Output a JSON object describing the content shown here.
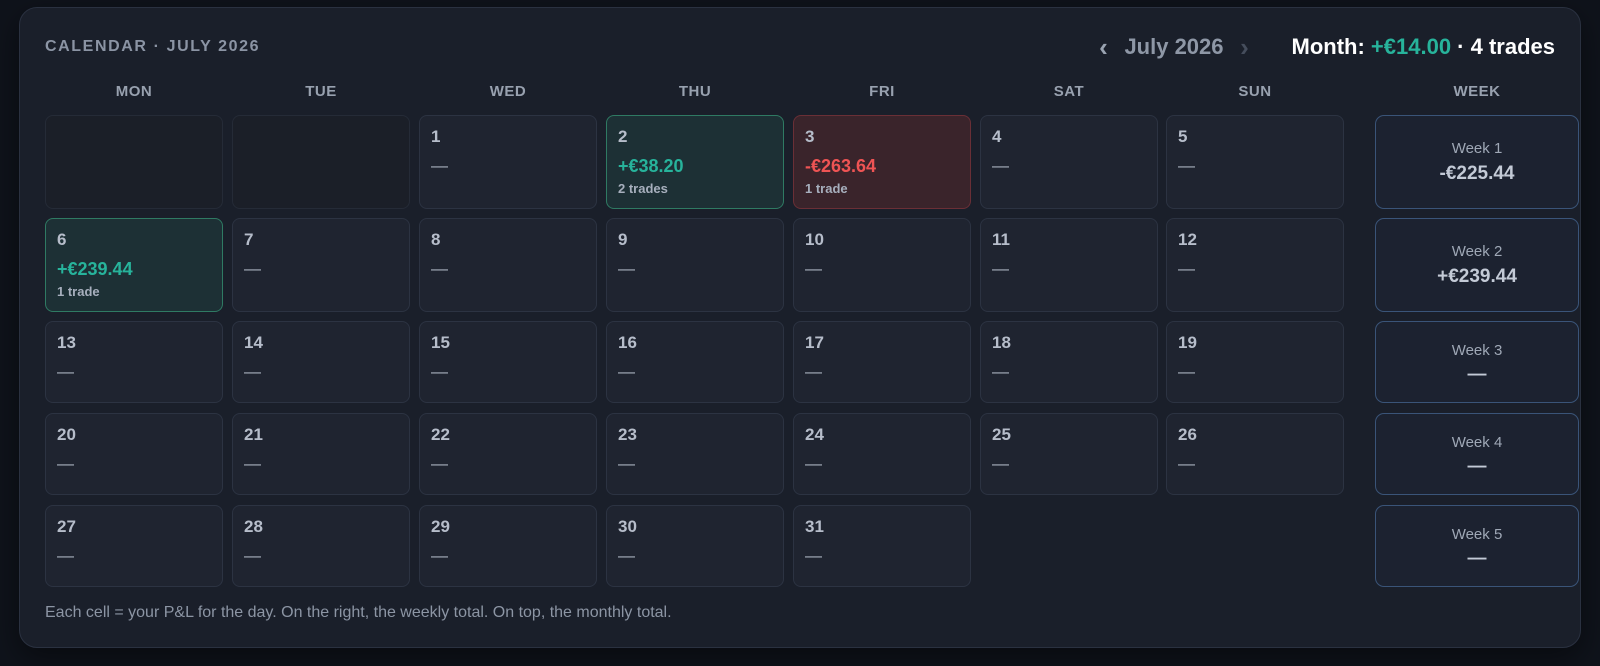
{
  "header": {
    "title": "CALENDAR · JULY 2026",
    "prev_icon": "chevron-left-icon",
    "next_icon": "chevron-right-icon",
    "prev_glyph": "‹",
    "next_glyph": "›",
    "month_label": "July 2026",
    "summary_prefix": "Month: ",
    "summary_value": "+€14.00",
    "summary_suffix": " · 4 trades"
  },
  "colors": {
    "positive": "#27b39b",
    "negative": "#ef5454",
    "background": "#0f131b",
    "panel": "#1a1f2a"
  },
  "weekdays": [
    "MON",
    "TUE",
    "WED",
    "THU",
    "FRI",
    "SAT",
    "SUN"
  ],
  "week_header": "WEEK",
  "weeks": [
    {
      "label": "Week 1",
      "total": "-€225.44",
      "status": "loss",
      "days": [
        {
          "day": "",
          "status": "empty"
        },
        {
          "day": "",
          "status": "empty"
        },
        {
          "day": "1",
          "pnl": "—",
          "status": "none"
        },
        {
          "day": "2",
          "pnl": "+€38.20",
          "trades": "2 trades",
          "status": "win"
        },
        {
          "day": "3",
          "pnl": "-€263.64",
          "trades": "1 trade",
          "status": "loss"
        },
        {
          "day": "4",
          "pnl": "—",
          "status": "none"
        },
        {
          "day": "5",
          "pnl": "—",
          "status": "none"
        }
      ]
    },
    {
      "label": "Week 2",
      "total": "+€239.44",
      "status": "win",
      "days": [
        {
          "day": "6",
          "pnl": "+€239.44",
          "trades": "1 trade",
          "status": "win"
        },
        {
          "day": "7",
          "pnl": "—",
          "status": "none"
        },
        {
          "day": "8",
          "pnl": "—",
          "status": "none"
        },
        {
          "day": "9",
          "pnl": "—",
          "status": "none"
        },
        {
          "day": "10",
          "pnl": "—",
          "status": "none"
        },
        {
          "day": "11",
          "pnl": "—",
          "status": "none"
        },
        {
          "day": "12",
          "pnl": "—",
          "status": "none"
        }
      ]
    },
    {
      "label": "Week 3",
      "total": "—",
      "status": "none",
      "days": [
        {
          "day": "13",
          "pnl": "—",
          "status": "none"
        },
        {
          "day": "14",
          "pnl": "—",
          "status": "none"
        },
        {
          "day": "15",
          "pnl": "—",
          "status": "none"
        },
        {
          "day": "16",
          "pnl": "—",
          "status": "none"
        },
        {
          "day": "17",
          "pnl": "—",
          "status": "none"
        },
        {
          "day": "18",
          "pnl": "—",
          "status": "none"
        },
        {
          "day": "19",
          "pnl": "—",
          "status": "none"
        }
      ]
    },
    {
      "label": "Week 4",
      "total": "—",
      "status": "none",
      "days": [
        {
          "day": "20",
          "pnl": "—",
          "status": "none"
        },
        {
          "day": "21",
          "pnl": "—",
          "status": "none"
        },
        {
          "day": "22",
          "pnl": "—",
          "status": "none"
        },
        {
          "day": "23",
          "pnl": "—",
          "status": "none"
        },
        {
          "day": "24",
          "pnl": "—",
          "status": "none"
        },
        {
          "day": "25",
          "pnl": "—",
          "status": "none"
        },
        {
          "day": "26",
          "pnl": "—",
          "status": "none"
        }
      ]
    },
    {
      "label": "Week 5",
      "total": "—",
      "status": "none",
      "days": [
        {
          "day": "27",
          "pnl": "—",
          "status": "none"
        },
        {
          "day": "28",
          "pnl": "—",
          "status": "none"
        },
        {
          "day": "29",
          "pnl": "—",
          "status": "none"
        },
        {
          "day": "30",
          "pnl": "—",
          "status": "none"
        },
        {
          "day": "31",
          "pnl": "—",
          "status": "none"
        }
      ]
    }
  ],
  "footnote": "Each cell = your P&L for the day. On the right, the weekly total. On top, the monthly total."
}
